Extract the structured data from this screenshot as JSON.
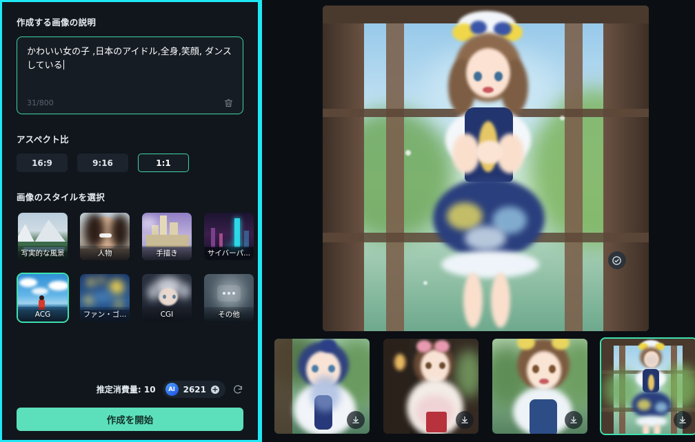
{
  "theme": {
    "panel_highlight": "#1fe8f5",
    "accent_mint": "#3ee2b0",
    "accent_button": "#5ce0bc",
    "panel_bg": "#11161d",
    "app_bg": "#0b0f14",
    "input_border": "#3dd6a6"
  },
  "left_panel": {
    "prompt_section": {
      "label": "作成する画像の説明",
      "value": "かわいい女の子 ,日本のアイドル,全身,笑顔, ダンスしている",
      "char_count": "31/800",
      "clear_icon": "trash-icon"
    },
    "aspect_section": {
      "label": "アスペクト比",
      "options": [
        {
          "label": "16:9",
          "selected": false
        },
        {
          "label": "9:16",
          "selected": false
        },
        {
          "label": "1:1",
          "selected": true
        }
      ]
    },
    "style_section": {
      "label": "画像のスタイルを選択",
      "styles": [
        {
          "label": "写実的な風景",
          "selected": false,
          "art": "landscape"
        },
        {
          "label": "人物",
          "selected": false,
          "art": "portrait"
        },
        {
          "label": "手描き",
          "selected": false,
          "art": "castle"
        },
        {
          "label": "サイバーパ...",
          "selected": false,
          "art": "cyberpunk"
        },
        {
          "label": "ACG",
          "selected": true,
          "art": "acg"
        },
        {
          "label": "ファン・ゴ...",
          "selected": false,
          "art": "vangogh"
        },
        {
          "label": "CGI",
          "selected": false,
          "art": "cgi"
        },
        {
          "label": "その他",
          "selected": false,
          "art": "more"
        }
      ]
    },
    "footer": {
      "cost_label": "推定消費量: 10",
      "credit_icon": "ai-badge-icon",
      "credit_badge_text": "AI",
      "credit_amount": "2621",
      "add_credit_icon": "plus-circle-icon",
      "refresh_icon": "refresh-icon",
      "create_button": "作成を開始"
    }
  },
  "right_panel": {
    "preview": {
      "name": "generated-image-preview",
      "art": "main",
      "confirm_icon": "check-circle-icon"
    },
    "thumbnails": [
      {
        "name": "thumbnail-1",
        "selected": false,
        "art": "thumb1",
        "download_icon": "download-icon"
      },
      {
        "name": "thumbnail-2",
        "selected": false,
        "art": "thumb2",
        "download_icon": "download-icon"
      },
      {
        "name": "thumbnail-3",
        "selected": false,
        "art": "thumb3",
        "download_icon": "download-icon"
      },
      {
        "name": "thumbnail-4",
        "selected": true,
        "art": "thumb4",
        "download_icon": "download-icon"
      }
    ]
  }
}
